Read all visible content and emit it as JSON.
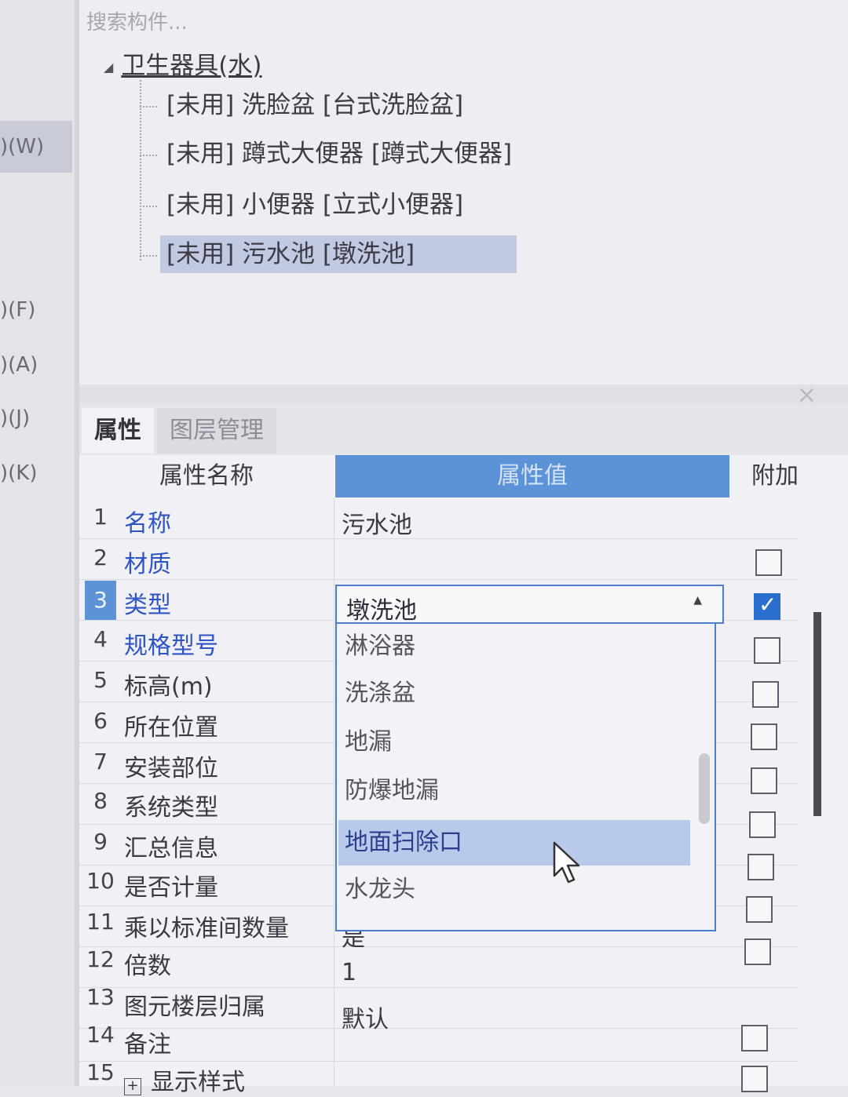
{
  "left_panel": {
    "items": [
      ")(W)",
      ")(F)",
      ")(A)",
      ")(J)",
      ")(K)"
    ]
  },
  "tree": {
    "search_placeholder": "搜索构件...",
    "root_label": "卫生器具(水)",
    "children": [
      "[未用] 洗脸盆 [台式洗脸盆]",
      "[未用] 蹲式大便器 [蹲式大便器]",
      "[未用] 小便器 [立式小便器]",
      "[未用] 污水池 [墩洗池]"
    ],
    "selected_index": 3
  },
  "tabs": {
    "active": "属性",
    "inactive": "图层管理"
  },
  "table": {
    "col_name": "属性名称",
    "col_value": "属性值",
    "col_extra": "附加",
    "rows": [
      {
        "num": "1",
        "name": "名称",
        "value": "污水池"
      },
      {
        "num": "2",
        "name": "材质",
        "value": ""
      },
      {
        "num": "3",
        "name": "类型",
        "value": "墩洗池"
      },
      {
        "num": "4",
        "name": "规格型号",
        "value": ""
      },
      {
        "num": "5",
        "name": "标高(m)",
        "value": ""
      },
      {
        "num": "6",
        "name": "所在位置",
        "value": ""
      },
      {
        "num": "7",
        "name": "安装部位",
        "value": ""
      },
      {
        "num": "8",
        "name": "系统类型",
        "value": ""
      },
      {
        "num": "9",
        "name": "汇总信息",
        "value": ""
      },
      {
        "num": "10",
        "name": "是否计量",
        "value": ""
      },
      {
        "num": "11",
        "name": "乘以标准间数量",
        "value": "是"
      },
      {
        "num": "12",
        "name": "倍数",
        "value": "1"
      },
      {
        "num": "13",
        "name": "图元楼层归属",
        "value": "默认"
      },
      {
        "num": "14",
        "name": "备注",
        "value": ""
      },
      {
        "num": "15",
        "name": "显示样式",
        "value": ""
      }
    ]
  },
  "dropdown": {
    "value": "墩洗池",
    "options": [
      "淋浴器",
      "洗涤盆",
      "地漏",
      "防爆地漏",
      "地面扫除口",
      "水龙头"
    ],
    "hover_index": 4
  },
  "colors": {
    "accent": "#5b93d6",
    "link_blue": "#2f55c4",
    "checkbox_checked": "#2a6fd0"
  }
}
